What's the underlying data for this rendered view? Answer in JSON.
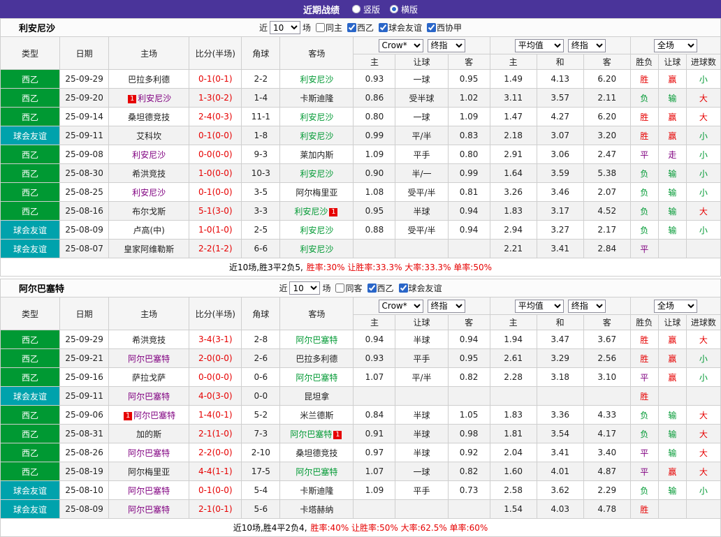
{
  "topbar": {
    "title": "近期战绩",
    "radios": [
      {
        "label": "竖版",
        "selected": false
      },
      {
        "label": "横版",
        "selected": true
      }
    ]
  },
  "controls": {
    "near": "近",
    "count": "10",
    "games": "场"
  },
  "table_head": {
    "left": [
      "类型",
      "日期",
      "主场",
      "比分(半场)",
      "角球",
      "客场"
    ],
    "company_select": "Crow*",
    "final_select": "终指",
    "average_select": "平均值",
    "full_select": "全场",
    "sub": [
      "主",
      "让球",
      "客",
      "主",
      "和",
      "客",
      "胜负",
      "让球",
      "进球数"
    ]
  },
  "colors": {
    "topbar_bg": "#4a349a",
    "radio_blue": "#2a66c8",
    "league_green": "#009933",
    "friendly_teal": "#00a2ac",
    "text_red": "#e60000",
    "text_green": "#009933",
    "text_purple": "#800080",
    "border": "#cfcfcf",
    "header_bg": "#f5f5f5",
    "row_alt": "#f2f2f2"
  },
  "sections": [
    {
      "team": "利安尼沙",
      "filters": [
        {
          "label": "同主",
          "checked": false
        },
        {
          "label": "西乙",
          "checked": true
        },
        {
          "label": "球会友谊",
          "checked": true
        },
        {
          "label": "西协甲",
          "checked": true
        }
      ],
      "rows": [
        {
          "t": "西乙",
          "k": "g",
          "d": "25-09-29",
          "h": "巴拉多利德",
          "hc": "",
          "hb": "",
          "s": "0-1(0-1)",
          "c": "2-2",
          "a": "利安尼沙",
          "ac": "fa",
          "ab": "",
          "o": [
            "0.93",
            "一球",
            "0.95",
            "1.49",
            "4.13",
            "6.20"
          ],
          "r": [
            [
              "胜",
              "r"
            ],
            [
              "赢",
              "r"
            ],
            [
              "小",
              "g"
            ]
          ]
        },
        {
          "t": "西乙",
          "k": "g",
          "d": "25-09-20",
          "h": "利安尼沙",
          "hc": "fh",
          "hb": "1",
          "s": "1-3(0-2)",
          "c": "1-4",
          "a": "卡斯迪隆",
          "ac": "",
          "ab": "",
          "o": [
            "0.86",
            "受半球",
            "1.02",
            "3.11",
            "3.57",
            "2.11"
          ],
          "r": [
            [
              "负",
              "g"
            ],
            [
              "输",
              "g"
            ],
            [
              "大",
              "r"
            ]
          ]
        },
        {
          "t": "西乙",
          "k": "g",
          "d": "25-09-14",
          "h": "桑坦德竞技",
          "hc": "",
          "hb": "",
          "s": "2-4(0-3)",
          "c": "11-1",
          "a": "利安尼沙",
          "ac": "fa",
          "ab": "",
          "o": [
            "0.80",
            "一球",
            "1.09",
            "1.47",
            "4.27",
            "6.20"
          ],
          "r": [
            [
              "胜",
              "r"
            ],
            [
              "赢",
              "r"
            ],
            [
              "大",
              "r"
            ]
          ]
        },
        {
          "t": "球会友谊",
          "k": "t",
          "d": "25-09-11",
          "h": "艾科坎",
          "hc": "",
          "hb": "",
          "s": "0-1(0-0)",
          "c": "1-8",
          "a": "利安尼沙",
          "ac": "fa",
          "ab": "",
          "o": [
            "0.99",
            "平/半",
            "0.83",
            "2.18",
            "3.07",
            "3.20"
          ],
          "r": [
            [
              "胜",
              "r"
            ],
            [
              "赢",
              "r"
            ],
            [
              "小",
              "g"
            ]
          ]
        },
        {
          "t": "西乙",
          "k": "g",
          "d": "25-09-08",
          "h": "利安尼沙",
          "hc": "fh",
          "hb": "",
          "s": "0-0(0-0)",
          "c": "9-3",
          "a": "莱加内斯",
          "ac": "",
          "ab": "",
          "o": [
            "1.09",
            "平手",
            "0.80",
            "2.91",
            "3.06",
            "2.47"
          ],
          "r": [
            [
              "平",
              "p"
            ],
            [
              "走",
              "p"
            ],
            [
              "小",
              "g"
            ]
          ]
        },
        {
          "t": "西乙",
          "k": "g",
          "d": "25-08-30",
          "h": "希洪竞技",
          "hc": "",
          "hb": "",
          "s": "1-0(0-0)",
          "c": "10-3",
          "a": "利安尼沙",
          "ac": "fa",
          "ab": "",
          "o": [
            "0.90",
            "半/一",
            "0.99",
            "1.64",
            "3.59",
            "5.38"
          ],
          "r": [
            [
              "负",
              "g"
            ],
            [
              "输",
              "g"
            ],
            [
              "小",
              "g"
            ]
          ]
        },
        {
          "t": "西乙",
          "k": "g",
          "d": "25-08-25",
          "h": "利安尼沙",
          "hc": "fh",
          "hb": "",
          "s": "0-1(0-0)",
          "c": "3-5",
          "a": "阿尔梅里亚",
          "ac": "",
          "ab": "",
          "o": [
            "1.08",
            "受平/半",
            "0.81",
            "3.26",
            "3.46",
            "2.07"
          ],
          "r": [
            [
              "负",
              "g"
            ],
            [
              "输",
              "g"
            ],
            [
              "小",
              "g"
            ]
          ]
        },
        {
          "t": "西乙",
          "k": "g",
          "d": "25-08-16",
          "h": "布尔戈斯",
          "hc": "",
          "hb": "",
          "s": "5-1(3-0)",
          "c": "3-3",
          "a": "利安尼沙",
          "ac": "fa",
          "ab": "1",
          "o": [
            "0.95",
            "半球",
            "0.94",
            "1.83",
            "3.17",
            "4.52"
          ],
          "r": [
            [
              "负",
              "g"
            ],
            [
              "输",
              "g"
            ],
            [
              "大",
              "r"
            ]
          ]
        },
        {
          "t": "球会友谊",
          "k": "t",
          "d": "25-08-09",
          "h": "卢高(中)",
          "hc": "",
          "hb": "",
          "s": "1-0(1-0)",
          "c": "2-5",
          "a": "利安尼沙",
          "ac": "fa",
          "ab": "",
          "o": [
            "0.88",
            "受平/半",
            "0.94",
            "2.94",
            "3.27",
            "2.17"
          ],
          "r": [
            [
              "负",
              "g"
            ],
            [
              "输",
              "g"
            ],
            [
              "小",
              "g"
            ]
          ]
        },
        {
          "t": "球会友谊",
          "k": "t",
          "d": "25-08-07",
          "h": "皇家阿维勒斯",
          "hc": "",
          "hb": "",
          "s": "2-2(1-2)",
          "c": "6-6",
          "a": "利安尼沙",
          "ac": "fa",
          "ab": "",
          "o": [
            "",
            "",
            "",
            "2.21",
            "3.41",
            "2.84"
          ],
          "r": [
            [
              "平",
              "p"
            ],
            [
              "",
              ""
            ],
            [
              "",
              ""
            ]
          ]
        }
      ],
      "summary_prefix": "近10场,胜3平2负5,",
      "summary_stats": "胜率:30% 让胜率:33.3% 大率:33.3% 单率:50%"
    },
    {
      "team": "阿尔巴塞特",
      "filters": [
        {
          "label": "同客",
          "checked": false
        },
        {
          "label": "西乙",
          "checked": true
        },
        {
          "label": "球会友谊",
          "checked": true
        }
      ],
      "rows": [
        {
          "t": "西乙",
          "k": "g",
          "d": "25-09-29",
          "h": "希洪竞技",
          "hc": "",
          "hb": "",
          "s": "3-4(3-1)",
          "c": "2-8",
          "a": "阿尔巴塞特",
          "ac": "fa",
          "ab": "",
          "o": [
            "0.94",
            "半球",
            "0.94",
            "1.94",
            "3.47",
            "3.67"
          ],
          "r": [
            [
              "胜",
              "r"
            ],
            [
              "赢",
              "r"
            ],
            [
              "大",
              "r"
            ]
          ]
        },
        {
          "t": "西乙",
          "k": "g",
          "d": "25-09-21",
          "h": "阿尔巴塞特",
          "hc": "fh",
          "hb": "",
          "s": "2-0(0-0)",
          "c": "2-6",
          "a": "巴拉多利德",
          "ac": "",
          "ab": "",
          "o": [
            "0.93",
            "平手",
            "0.95",
            "2.61",
            "3.29",
            "2.56"
          ],
          "r": [
            [
              "胜",
              "r"
            ],
            [
              "赢",
              "r"
            ],
            [
              "小",
              "g"
            ]
          ]
        },
        {
          "t": "西乙",
          "k": "g",
          "d": "25-09-16",
          "h": "萨拉戈萨",
          "hc": "",
          "hb": "",
          "s": "0-0(0-0)",
          "c": "0-6",
          "a": "阿尔巴塞特",
          "ac": "fa",
          "ab": "",
          "o": [
            "1.07",
            "平/半",
            "0.82",
            "2.28",
            "3.18",
            "3.10"
          ],
          "r": [
            [
              "平",
              "p"
            ],
            [
              "赢",
              "r"
            ],
            [
              "小",
              "g"
            ]
          ]
        },
        {
          "t": "球会友谊",
          "k": "t",
          "d": "25-09-11",
          "h": "阿尔巴塞特",
          "hc": "fh",
          "hb": "",
          "s": "4-0(3-0)",
          "c": "0-0",
          "a": "昆坦拿",
          "ac": "",
          "ab": "",
          "o": [
            "",
            "",
            "",
            "",
            "",
            ""
          ],
          "r": [
            [
              "胜",
              "r"
            ],
            [
              "",
              ""
            ],
            [
              "",
              ""
            ]
          ]
        },
        {
          "t": "西乙",
          "k": "g",
          "d": "25-09-06",
          "h": "阿尔巴塞特",
          "hc": "fh",
          "hb": "1",
          "s": "1-4(0-1)",
          "c": "5-2",
          "a": "米兰德斯",
          "ac": "",
          "ab": "",
          "o": [
            "0.84",
            "半球",
            "1.05",
            "1.83",
            "3.36",
            "4.33"
          ],
          "r": [
            [
              "负",
              "g"
            ],
            [
              "输",
              "g"
            ],
            [
              "大",
              "r"
            ]
          ]
        },
        {
          "t": "西乙",
          "k": "g",
          "d": "25-08-31",
          "h": "加的斯",
          "hc": "",
          "hb": "",
          "s": "2-1(1-0)",
          "c": "7-3",
          "a": "阿尔巴塞特",
          "ac": "fa",
          "ab": "1",
          "o": [
            "0.91",
            "半球",
            "0.98",
            "1.81",
            "3.54",
            "4.17"
          ],
          "r": [
            [
              "负",
              "g"
            ],
            [
              "输",
              "g"
            ],
            [
              "大",
              "r"
            ]
          ]
        },
        {
          "t": "西乙",
          "k": "g",
          "d": "25-08-26",
          "h": "阿尔巴塞特",
          "hc": "fh",
          "hb": "",
          "s": "2-2(0-0)",
          "c": "2-10",
          "a": "桑坦德竞技",
          "ac": "",
          "ab": "",
          "o": [
            "0.97",
            "半球",
            "0.92",
            "2.04",
            "3.41",
            "3.40"
          ],
          "r": [
            [
              "平",
              "p"
            ],
            [
              "输",
              "g"
            ],
            [
              "大",
              "r"
            ]
          ]
        },
        {
          "t": "西乙",
          "k": "g",
          "d": "25-08-19",
          "h": "阿尔梅里亚",
          "hc": "",
          "hb": "",
          "s": "4-4(1-1)",
          "c": "17-5",
          "a": "阿尔巴塞特",
          "ac": "fa",
          "ab": "",
          "o": [
            "1.07",
            "一球",
            "0.82",
            "1.60",
            "4.01",
            "4.87"
          ],
          "r": [
            [
              "平",
              "p"
            ],
            [
              "赢",
              "r"
            ],
            [
              "大",
              "r"
            ]
          ]
        },
        {
          "t": "球会友谊",
          "k": "t",
          "d": "25-08-10",
          "h": "阿尔巴塞特",
          "hc": "fh",
          "hb": "",
          "s": "0-1(0-0)",
          "c": "5-4",
          "a": "卡斯迪隆",
          "ac": "",
          "ab": "",
          "o": [
            "1.09",
            "平手",
            "0.73",
            "2.58",
            "3.62",
            "2.29"
          ],
          "r": [
            [
              "负",
              "g"
            ],
            [
              "输",
              "g"
            ],
            [
              "小",
              "g"
            ]
          ]
        },
        {
          "t": "球会友谊",
          "k": "t",
          "d": "25-08-09",
          "h": "阿尔巴塞特",
          "hc": "fh",
          "hb": "",
          "s": "2-1(0-1)",
          "c": "5-6",
          "a": "卡塔赫纳",
          "ac": "",
          "ab": "",
          "o": [
            "",
            "",
            "",
            "1.54",
            "4.03",
            "4.78"
          ],
          "r": [
            [
              "胜",
              "r"
            ],
            [
              "",
              ""
            ],
            [
              "",
              ""
            ]
          ]
        }
      ],
      "summary_prefix": "近10场,胜4平2负4,",
      "summary_stats": "胜率:40% 让胜率:50% 大率:62.5% 单率:60%"
    }
  ]
}
